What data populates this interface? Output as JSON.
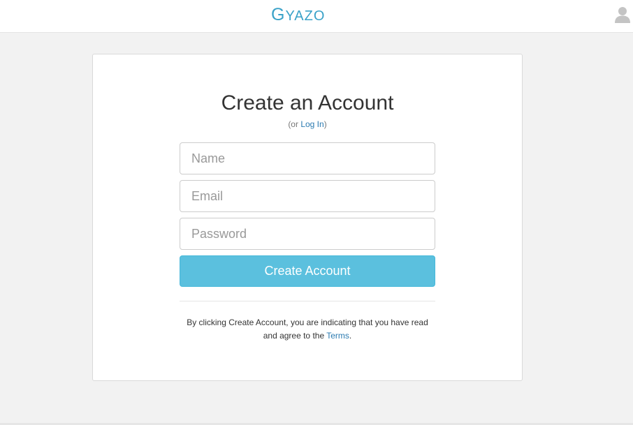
{
  "header": {
    "logo_first": "G",
    "logo_rest": "YAZO",
    "user_icon": "user-icon",
    "accent_color": "#3aa2c8"
  },
  "form": {
    "title": "Create an Account",
    "or_prefix": "(or ",
    "login_link": "Log In",
    "or_suffix": ")",
    "name_placeholder": "Name",
    "email_placeholder": "Email",
    "password_placeholder": "Password",
    "submit_label": "Create Account",
    "button_color": "#5bc0de"
  },
  "terms": {
    "line1": "By clicking Create Account, you are indicating that you have read",
    "line2_prefix": "and agree to the ",
    "link": "Terms",
    "line2_suffix": "."
  }
}
